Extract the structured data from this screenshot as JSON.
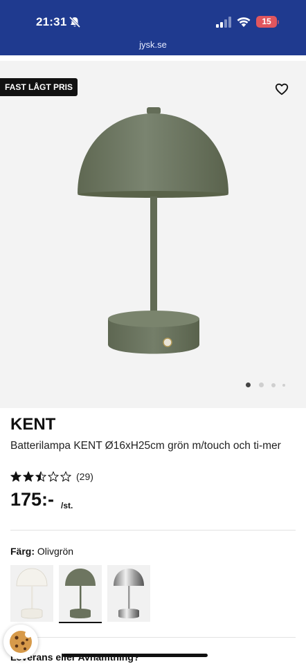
{
  "status_bar": {
    "time": "21:31",
    "battery": "15",
    "url": "jysk.se"
  },
  "hero": {
    "badge": "FAST LÅGT PRIS",
    "carousel_current": 1,
    "carousel_total": 4
  },
  "product": {
    "brand": "KENT",
    "description": "Batterilampa KENT Ø16xH25cm grön m/touch och ti-mer",
    "rating": 2.5,
    "rating_max": 5,
    "reviews": "(29)",
    "price": "175:-",
    "unit": "/st."
  },
  "color": {
    "label": "Färg:",
    "value": "Olivgrön",
    "options": [
      {
        "name": "white",
        "shade": "#f2f0ea",
        "selected": false
      },
      {
        "name": "olive",
        "shade": "#6d7560",
        "selected": true
      },
      {
        "name": "chrome",
        "shade": "#b8b8bc",
        "selected": false
      }
    ]
  },
  "delivery": {
    "label": "Leverans eller Avhämtning?"
  },
  "colors": {
    "header_bg": "#1f3a8f",
    "lamp_olive": "#6d7560",
    "battery": "#e0565e"
  }
}
